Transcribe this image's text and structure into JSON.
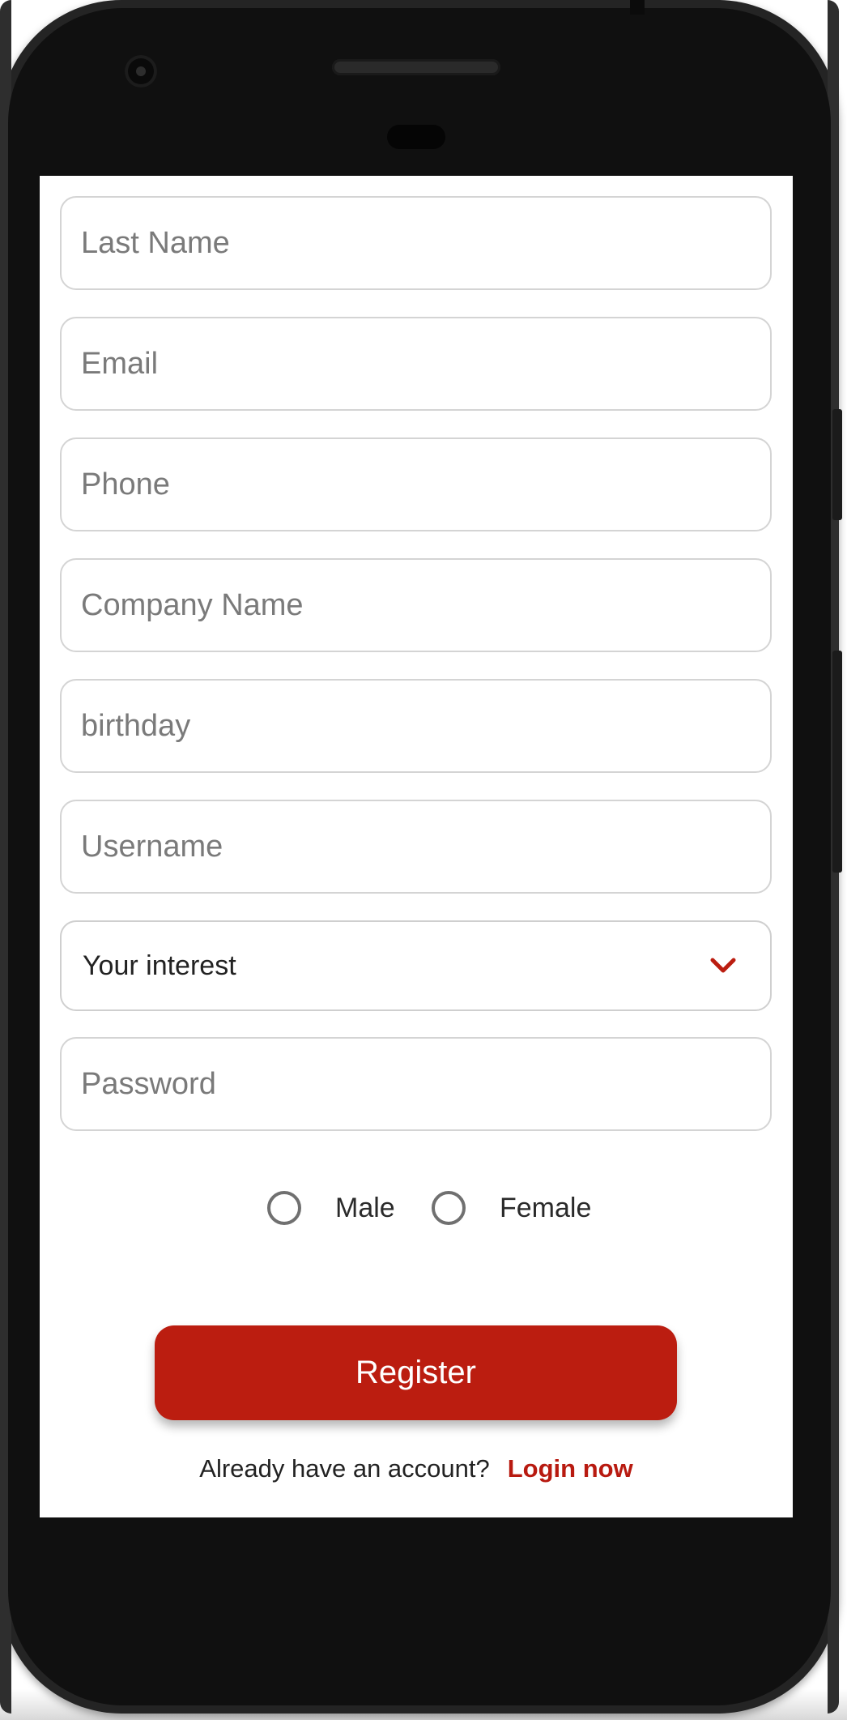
{
  "form": {
    "fields": [
      {
        "placeholder": "Last Name",
        "value": ""
      },
      {
        "placeholder": "Email",
        "value": ""
      },
      {
        "placeholder": "Phone",
        "value": ""
      },
      {
        "placeholder": "Company Name",
        "value": ""
      },
      {
        "placeholder": "birthday",
        "value": ""
      },
      {
        "placeholder": "Username",
        "value": ""
      }
    ],
    "interest": {
      "selected_label": "Your interest",
      "icon": "chevron-down-icon"
    },
    "password": {
      "placeholder": "Password",
      "value": ""
    },
    "gender": {
      "options": [
        "Male",
        "Female"
      ],
      "selected": null
    },
    "register_label": "Register",
    "login_prompt": "Already have an account?",
    "login_link": "Login now"
  },
  "colors": {
    "accent": "#bb1d10",
    "link": "#b81a10",
    "field_border": "#d4d4d4",
    "placeholder": "#7a7a7a",
    "phone_body": "#242424"
  }
}
